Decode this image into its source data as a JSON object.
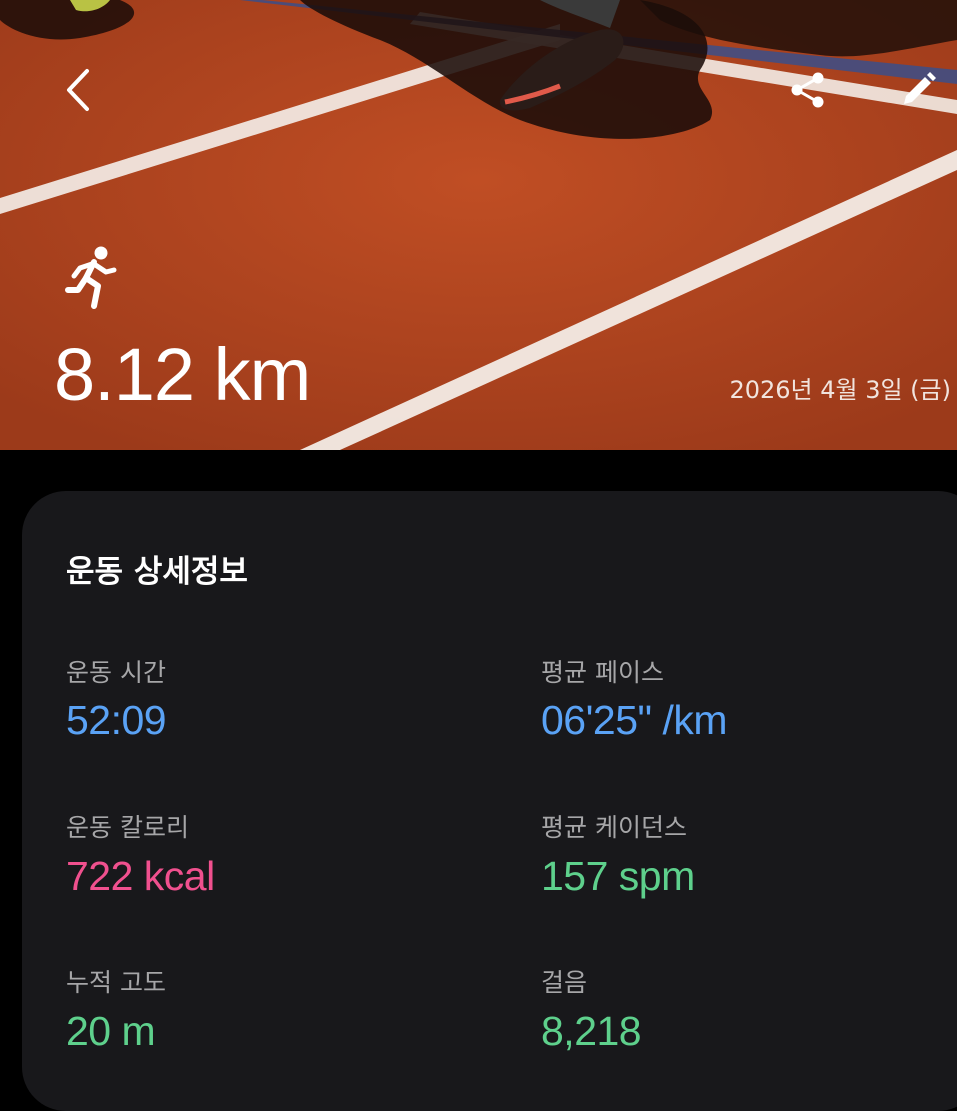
{
  "header": {
    "back_icon": "chevron-left-icon",
    "share_icon": "share-icon",
    "edit_icon": "pencil-icon",
    "activity_icon": "running-person-icon",
    "distance": "8.12 km",
    "date": "2026년 4월 3일 (금)"
  },
  "details": {
    "title": "운동 상세정보",
    "stats": [
      {
        "label": "운동 시간",
        "value": "52:09",
        "color": "#5aa2f5"
      },
      {
        "label": "평균 페이스",
        "value": "06'25\" /km",
        "color": "#5aa2f5"
      },
      {
        "label": "운동 칼로리",
        "value": "722 kcal",
        "color": "#f0508e"
      },
      {
        "label": "평균 케이던스",
        "value": "157 spm",
        "color": "#5ed08c"
      },
      {
        "label": "누적 고도",
        "value": "20 m",
        "color": "#5ed08c"
      },
      {
        "label": "걸음",
        "value": "8,218",
        "color": "#5ed08c"
      }
    ]
  },
  "colors": {
    "hero_track": "#b0441f",
    "card_background": "#18181b",
    "page_background": "#000000"
  }
}
